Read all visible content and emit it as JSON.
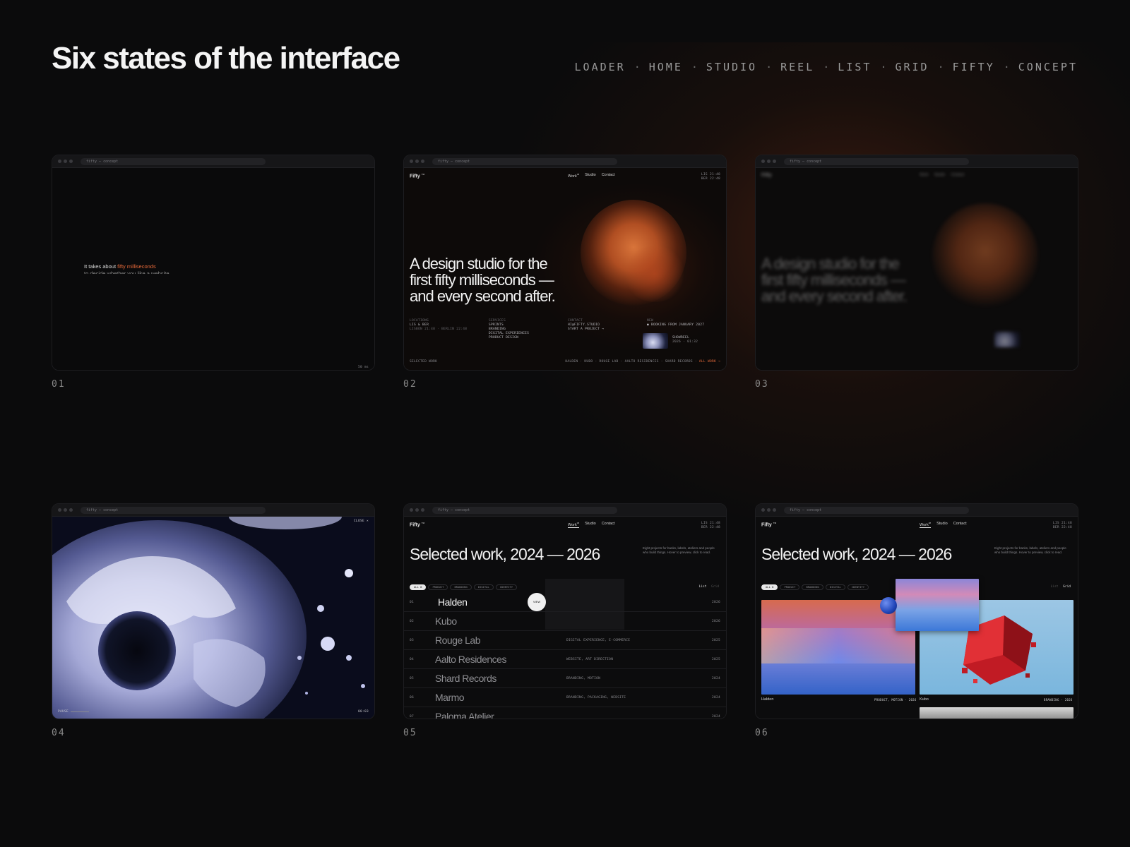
{
  "page": {
    "title": "Six states of the interface",
    "nav": [
      "LOADER",
      "HOME",
      "STUDIO",
      "REEL",
      "LIST",
      "GRID",
      "FIFTY",
      "CONCEPT"
    ],
    "nav_separator": "·"
  },
  "cards": [
    {
      "label": "01",
      "url": "fifty — concept"
    },
    {
      "label": "02",
      "url": "fifty — concept"
    },
    {
      "label": "03",
      "url": "fifty — concept"
    },
    {
      "label": "04",
      "url": "fifty — concept"
    },
    {
      "label": "05",
      "url": "fifty — concept"
    },
    {
      "label": "06",
      "url": "fifty — concept"
    }
  ],
  "loader": {
    "line1_prefix": "It takes about ",
    "line1_accent": "fifty milliseconds",
    "line2": "to decide whether you like a website",
    "counter": "50 ms"
  },
  "site": {
    "logo": "Fifty",
    "logo_mark": "TM",
    "menu": [
      "Work",
      "Studio",
      "Contact"
    ],
    "work_count": "08",
    "clock_line1": "LIS 21:48",
    "clock_line2": "BER 22:48"
  },
  "home": {
    "hero_line1": "A design studio for the",
    "hero_line2": "first fifty milliseconds —",
    "hero_line3": "and every second after.",
    "col_locations_h": "LOCATIONS",
    "col_locations_v1": "LIS & BER",
    "col_locations_v2": "LISBON 21:48 · BERLIN 22:48",
    "col_services_h": "SERVICES",
    "col_services_v1": "SPRINTS",
    "col_services_v2": "BRANDING",
    "col_services_v3": "DIGITAL EXPERIENCES",
    "col_services_v4": "PRODUCT DESIGN",
    "col_contact_h": "CONTACT",
    "col_contact_v1": "HI@FIFTY.STUDIO",
    "col_contact_v2": "START A PROJECT →",
    "col_new_h": "NEW",
    "col_new_v1": "● BOOKING FROM JANUARY 2027",
    "col_new_thumb_title": "SHOWREEL",
    "col_new_thumb_sub": "2026 · 01:32",
    "footer_left": "SELECTED WORK",
    "footer_links": "HALDEN · KUBO · ROUGE LAB · AALTO RESIDENCES · SHARD RECORDS",
    "footer_all": "ALL WORK →"
  },
  "reel": {
    "top_right": "CLOSE ×",
    "bottom_left": "PAUSE",
    "bottom_right": "00:03"
  },
  "work": {
    "title": "Selected work, 2024 — 2026",
    "blurb": "Eight projects for banks, labels, ateliers and people who build things. Hover to preview, click to read.",
    "filters": [
      "ALL 8",
      "PRODUCT",
      "BRANDING",
      "DIGITAL",
      "IDENTITY"
    ],
    "view_list": "List",
    "view_grid": "Grid",
    "bubble": "VIEW",
    "projects": [
      {
        "idx": "01",
        "name": "Halden",
        "tags": "",
        "year": "2026"
      },
      {
        "idx": "02",
        "name": "Kubo",
        "tags": "",
        "year": "2026"
      },
      {
        "idx": "03",
        "name": "Rouge Lab",
        "tags": "DIGITAL EXPERIENCE, E-COMMERCE",
        "year": "2025"
      },
      {
        "idx": "04",
        "name": "Aalto Residences",
        "tags": "WEBSITE, ART DIRECTION",
        "year": "2025"
      },
      {
        "idx": "05",
        "name": "Shard Records",
        "tags": "BRANDING, MOTION",
        "year": "2024"
      },
      {
        "idx": "06",
        "name": "Marmo",
        "tags": "BRANDING, PACKAGING, WEBSITE",
        "year": "2024"
      },
      {
        "idx": "07",
        "name": "Paloma Atelier",
        "tags": "",
        "year": "2024"
      }
    ],
    "grid_cap1": "Halden",
    "grid_cap1_meta": "PRODUCT, MOTION · 2026",
    "grid_cap2": "Kubo",
    "grid_cap2_meta": "BRANDING · 2026"
  }
}
